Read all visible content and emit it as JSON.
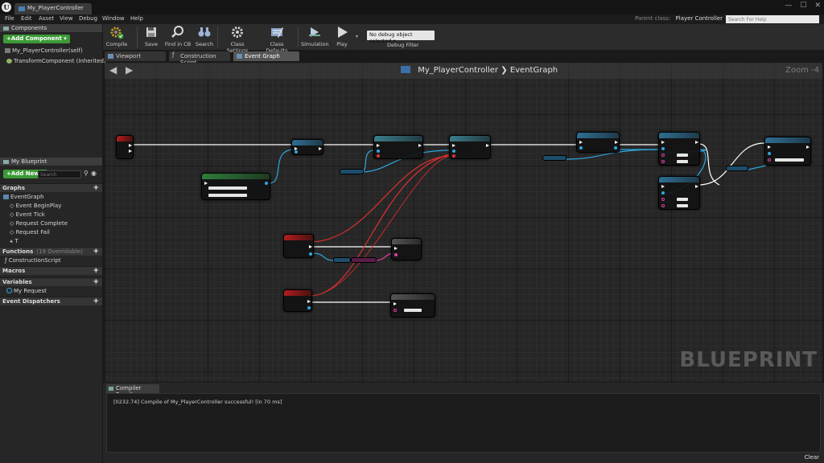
{
  "window": {
    "tab_title": "My_PlayerController",
    "minimize": "—",
    "maximize": "☐",
    "close": "✕"
  },
  "menu": [
    "File",
    "Edit",
    "Asset",
    "View",
    "Debug",
    "Window",
    "Help"
  ],
  "parent_class": {
    "label": "Parent class:",
    "value": "Player Controller"
  },
  "help_search": {
    "placeholder": "Search For Help"
  },
  "components": {
    "tab": "Components",
    "add_button": "+Add Component ▾",
    "items": [
      "My_PlayerController(self)",
      "TransformComponent (Inherited)"
    ]
  },
  "my_blueprint": {
    "tab": "My Blueprint",
    "add_new": "+Add New ▾",
    "search_placeholder": "Search",
    "graphs_header": "Graphs",
    "graphs": [
      "EventGraph",
      "Event BeginPlay",
      "Event Tick",
      "Request Complete",
      "Request Fail",
      "T"
    ],
    "functions_header": "Functions",
    "functions_sub": "(19 Overridable)",
    "functions": [
      "ConstructionScript"
    ],
    "macros_header": "Macros",
    "variables_header": "Variables",
    "variables": [
      "My Request"
    ],
    "dispatchers_header": "Event Dispatchers"
  },
  "toolbar": {
    "compile": "Compile",
    "save": "Save",
    "find": "Find in CB",
    "search": "Search",
    "class_settings": "Class Settings",
    "class_defaults": "Class Defaults",
    "simulation": "Simulation",
    "play": "Play",
    "debug_object": "No debug object selected ▾",
    "debug_filter": "Debug Filter"
  },
  "editor_tabs": [
    "Viewport",
    "Construction Script",
    "Event Graph"
  ],
  "graph": {
    "breadcrumb_bp": "My_PlayerController",
    "breadcrumb_sep": "❯",
    "breadcrumb_graph": "EventGraph",
    "zoom": "Zoom -4",
    "watermark": "BLUEPRINT"
  },
  "results": {
    "tab": "Compiler Results",
    "message": "[0232.74] Compile of My_PlayerController successful! [in 70 ms]",
    "clear": "Clear"
  },
  "colors": {
    "compile_ok": "#3d9a37",
    "exec_wire": "#ffffff",
    "object_wire": "#2ea7e0",
    "event_wire": "#e03030",
    "string_wire": "#e040a0"
  }
}
